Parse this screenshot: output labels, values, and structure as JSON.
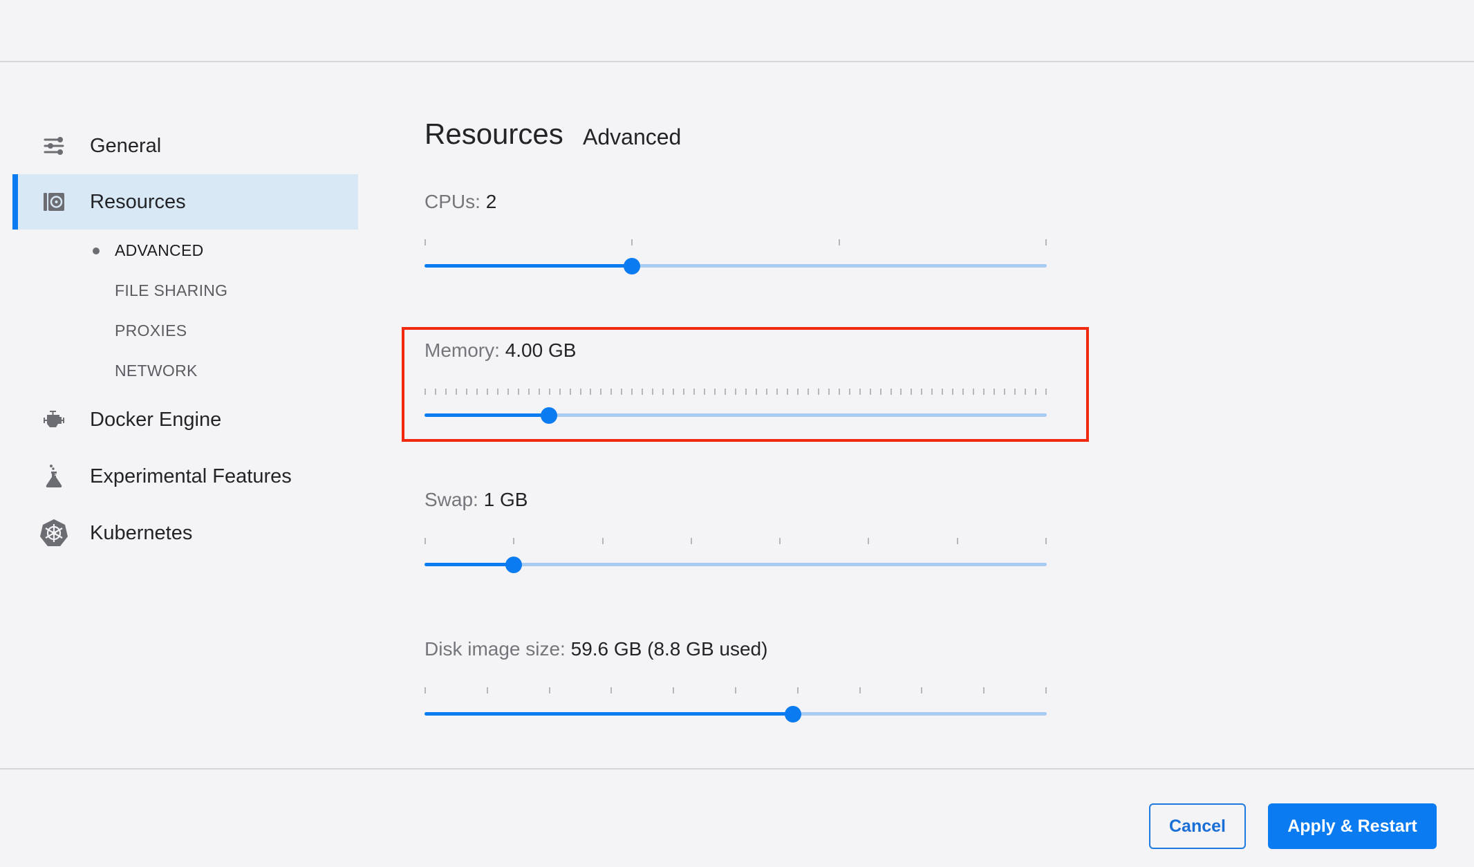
{
  "sidebar": {
    "items": [
      {
        "label": "General",
        "icon": "sliders-icon"
      },
      {
        "label": "Resources",
        "icon": "resources-icon",
        "active": true
      },
      {
        "label": "Docker Engine",
        "icon": "engine-icon"
      },
      {
        "label": "Experimental Features",
        "icon": "flask-icon"
      },
      {
        "label": "Kubernetes",
        "icon": "kubernetes-icon"
      }
    ],
    "resources_subitems": [
      {
        "label": "ADVANCED",
        "current": true
      },
      {
        "label": "FILE SHARING"
      },
      {
        "label": "PROXIES"
      },
      {
        "label": "NETWORK"
      }
    ]
  },
  "main": {
    "title": "Resources",
    "subtitle": "Advanced",
    "settings": {
      "cpus": {
        "label": "CPUs:",
        "value": "2",
        "ticks": 4,
        "fraction": 0.3333
      },
      "memory": {
        "label": "Memory:",
        "value": "4.00 GB",
        "ticks": 61,
        "fraction": 0.2,
        "highlighted": true
      },
      "swap": {
        "label": "Swap:",
        "value": "1 GB",
        "ticks": 8,
        "fraction": 0.1429
      },
      "disk": {
        "label": "Disk image size:",
        "value": "59.6 GB (8.8 GB used)",
        "ticks": 11,
        "fraction": 0.592
      }
    }
  },
  "footer": {
    "cancel_label": "Cancel",
    "apply_label": "Apply & Restart"
  },
  "colors": {
    "accent": "#0a7bf0",
    "track_inactive": "#a8cbf2",
    "highlight_box": "#f2290e",
    "active_nav_bg": "#d9e8f5"
  }
}
